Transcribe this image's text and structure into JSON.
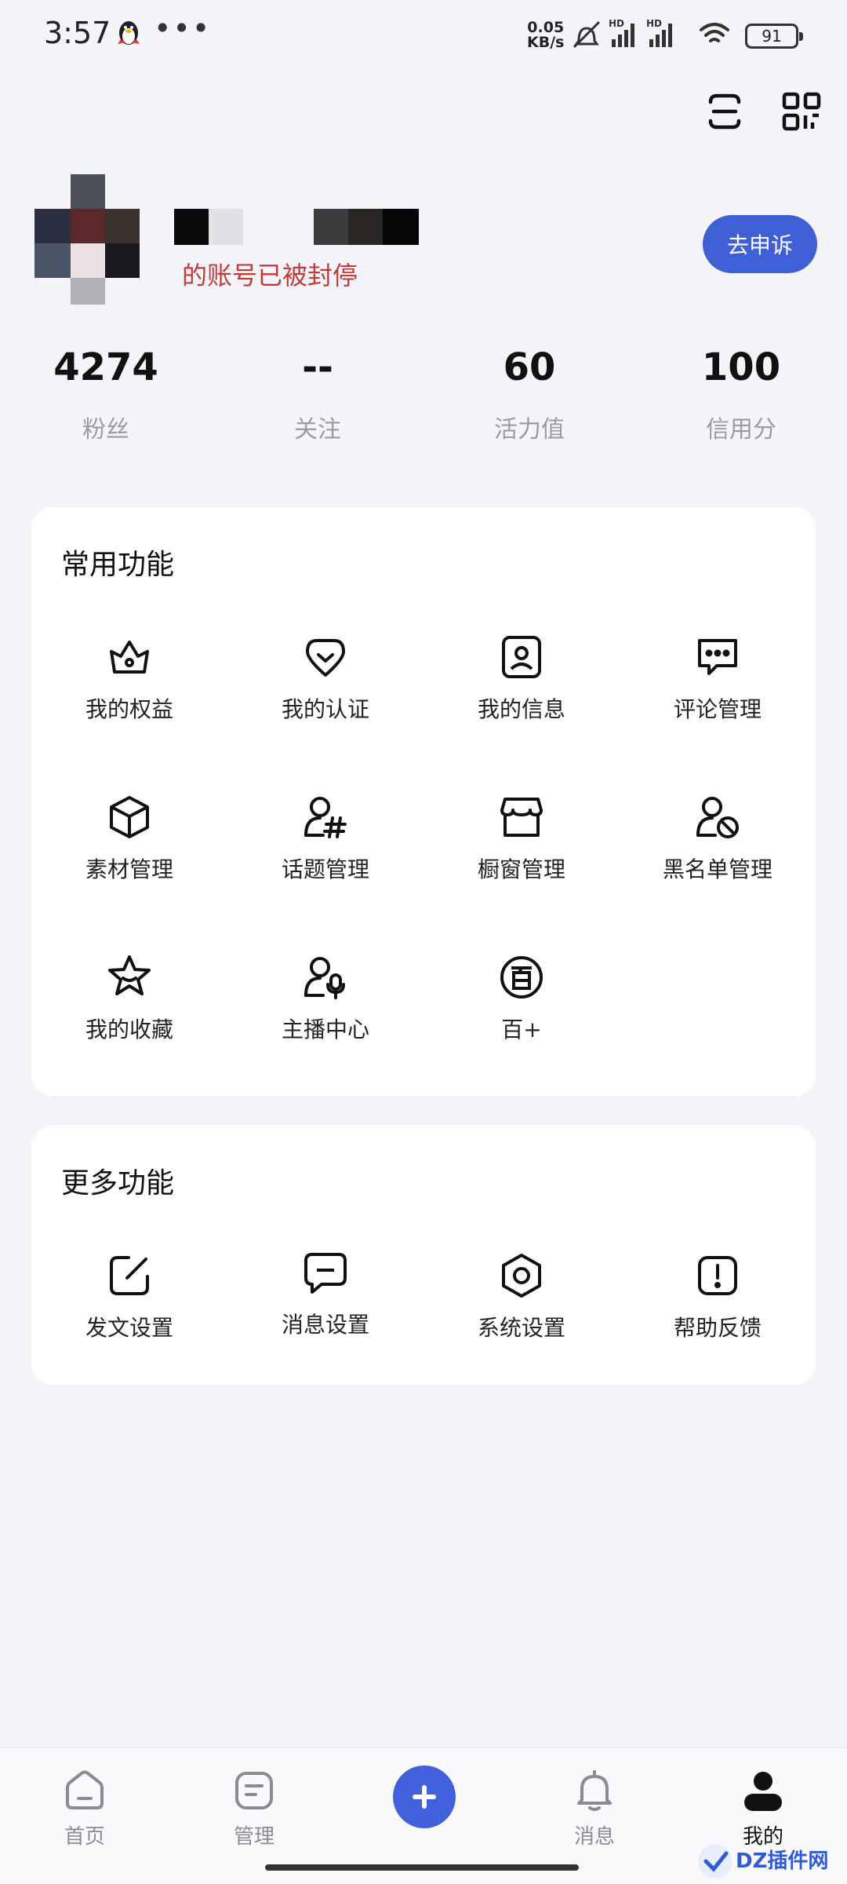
{
  "status_bar": {
    "time": "3:57",
    "net_speed_value": "0.05",
    "net_speed_unit": "KB/s",
    "battery": "91",
    "more_dots": "•••"
  },
  "profile": {
    "banned_notice": "的账号已被封停",
    "appeal_button": "去申诉"
  },
  "stats": [
    {
      "value": "4274",
      "label": "粉丝"
    },
    {
      "value": "--",
      "label": "关注"
    },
    {
      "value": "60",
      "label": "活力值"
    },
    {
      "value": "100",
      "label": "信用分"
    }
  ],
  "common_functions": {
    "title": "常用功能",
    "items": [
      {
        "label": "我的权益",
        "icon": "crown-icon"
      },
      {
        "label": "我的认证",
        "icon": "verify-heart-icon"
      },
      {
        "label": "我的信息",
        "icon": "profile-card-icon"
      },
      {
        "label": "评论管理",
        "icon": "comment-icon"
      },
      {
        "label": "素材管理",
        "icon": "cube-icon"
      },
      {
        "label": "话题管理",
        "icon": "user-hashtag-icon"
      },
      {
        "label": "橱窗管理",
        "icon": "shop-icon"
      },
      {
        "label": "黑名单管理",
        "icon": "user-block-icon"
      },
      {
        "label": "我的收藏",
        "icon": "star-icon"
      },
      {
        "label": "主播中心",
        "icon": "user-mic-icon"
      },
      {
        "label": "百+",
        "icon": "bai-plus-icon"
      }
    ]
  },
  "more_functions": {
    "title": "更多功能",
    "items": [
      {
        "label": "发文设置",
        "icon": "edit-icon"
      },
      {
        "label": "消息设置",
        "icon": "message-icon"
      },
      {
        "label": "系统设置",
        "icon": "settings-icon"
      },
      {
        "label": "帮助反馈",
        "icon": "help-icon"
      }
    ]
  },
  "bottom_nav": {
    "items": [
      {
        "label": "首页",
        "icon": "home-icon"
      },
      {
        "label": "管理",
        "icon": "manage-icon"
      },
      {
        "label": "消息",
        "icon": "bell-icon"
      },
      {
        "label": "我的",
        "icon": "user-icon",
        "active": true
      }
    ]
  },
  "colors": {
    "accent": "#3f5fd6",
    "banned_text": "#c23a3a",
    "background": "#f4f5f9"
  },
  "watermark": "DZ插件网"
}
